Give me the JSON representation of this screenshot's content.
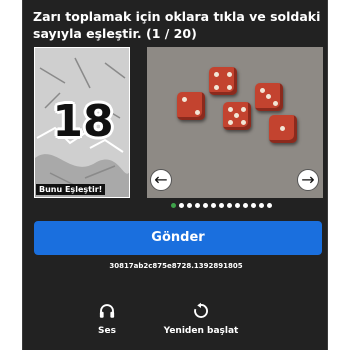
{
  "prompt": "Zarı toplamak için oklara tıkla ve soldaki sayıyla eşleştir. (1 / 20)",
  "left_card": {
    "number": "18",
    "caption": "Bunu Eşleştir!"
  },
  "right_card": {
    "image": "red-dice-photo"
  },
  "nav": {
    "prev_symbol": "←",
    "next_symbol": "→"
  },
  "pagination": {
    "total": 13,
    "active_index": 0
  },
  "submit_label": "Gönder",
  "session_id": "30817ab2c875e8728.1392891805",
  "footer": {
    "audio_label": "Ses",
    "restart_label": "Yeniden başlat"
  },
  "colors": {
    "background": "#222222",
    "accent": "#1a6fde",
    "active_dot": "#3ea34a",
    "die": "#c3432f"
  },
  "icons": [
    "headphones-icon",
    "restart-icon",
    "arrow-left-icon",
    "arrow-right-icon"
  ]
}
